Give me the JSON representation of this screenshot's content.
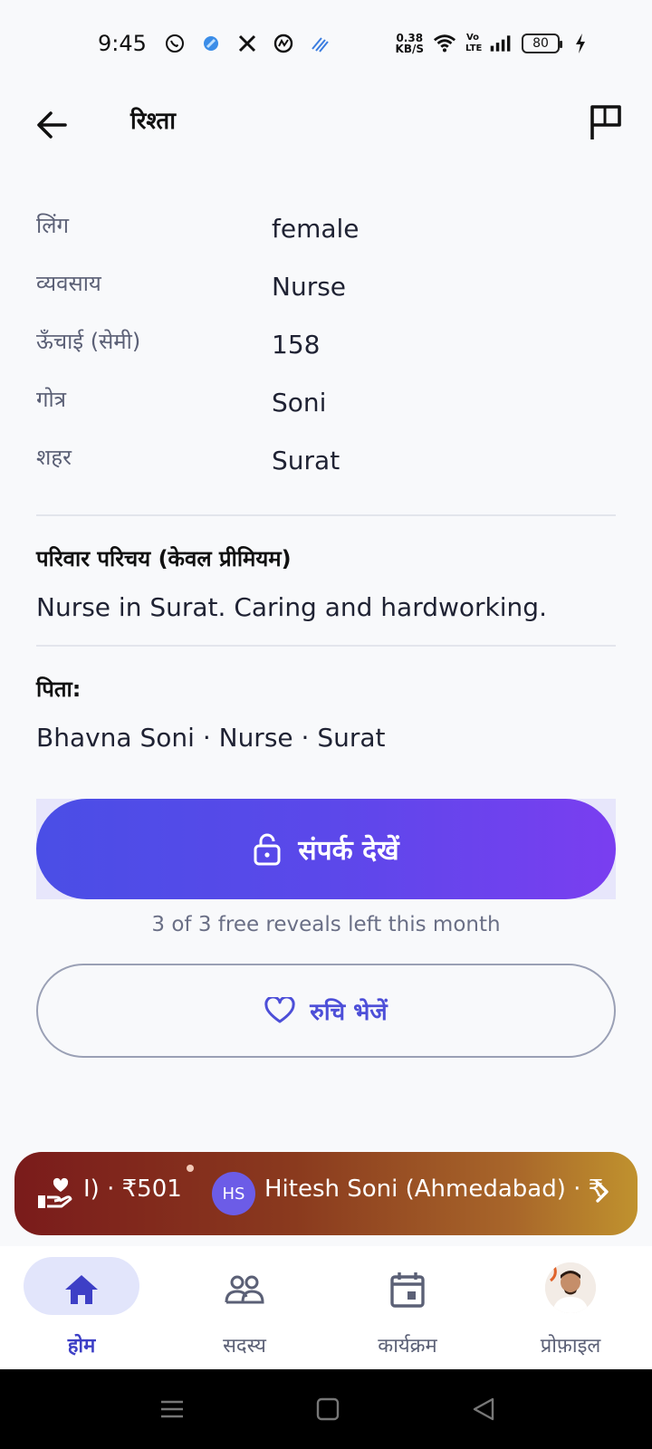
{
  "status_bar": {
    "time": "9:45",
    "icons": [
      "whatsapp-icon",
      "app-icon",
      "x-icon",
      "threads-icon",
      "app-icon"
    ],
    "speed_value": "0.38",
    "speed_unit": "KB/S",
    "volte": "Vo LTE",
    "battery": "80"
  },
  "appbar": {
    "title": "रिश्ता"
  },
  "details": [
    {
      "label": "लिंग",
      "value": "female"
    },
    {
      "label": "व्यवसाय",
      "value": "Nurse"
    },
    {
      "label": "ऊँचाई (सेमी)",
      "value": "158"
    },
    {
      "label": "गोत्र",
      "value": "Soni"
    },
    {
      "label": "शहर",
      "value": "Surat"
    }
  ],
  "family_intro": {
    "title": "परिवार परिचय (केवल प्रीमियम)",
    "text": "Nurse in Surat. Caring and hardworking."
  },
  "father": {
    "title": "पिता:",
    "text": "Bhavna Soni · Nurse · Surat"
  },
  "actions": {
    "contact_label": "संपर्क देखें",
    "reveal_note": "3 of 3 free reveals left this month",
    "interest_label": "रुचि भेजें"
  },
  "ticker": {
    "amount_text": "I) · ₹501",
    "avatar_initials": "HS",
    "name_text": "Hitesh Soni (Ahmedabad) · ₹"
  },
  "bottom_nav": [
    {
      "label": "होम",
      "icon": "home-icon",
      "active": true
    },
    {
      "label": "सदस्य",
      "icon": "members-icon",
      "active": false
    },
    {
      "label": "कार्यक्रम",
      "icon": "calendar-icon",
      "active": false
    },
    {
      "label": "प्रोफ़ाइल",
      "icon": "profile-photo",
      "active": false
    }
  ],
  "colors": {
    "accent": "#4d4fd8",
    "gradient_start": "#4a4ee6",
    "gradient_end": "#7a3ef0",
    "ticker_start": "#7a1b1b",
    "ticker_end": "#c0922e"
  }
}
